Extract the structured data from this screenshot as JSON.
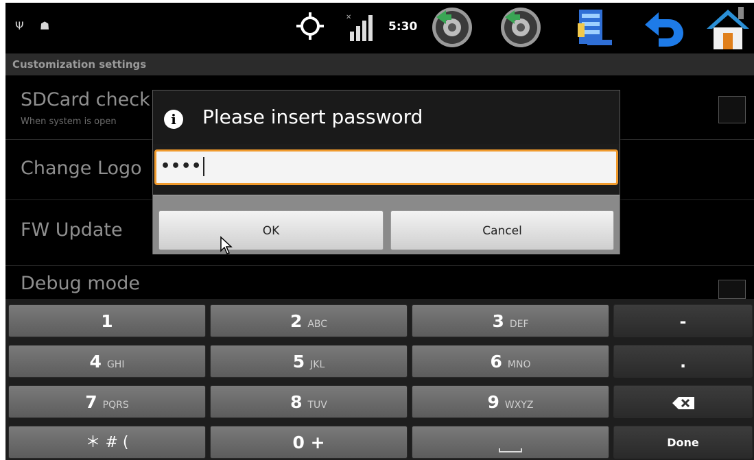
{
  "status_bar": {
    "usb_glyph": "Ψ",
    "android_glyph": "☗",
    "signal_x": "✕",
    "time": "5:30"
  },
  "settings": {
    "header": "Customization settings",
    "items": [
      {
        "title": "SDCard check",
        "subtitle": "When system is open"
      },
      {
        "title": "Change Logo",
        "subtitle": ""
      },
      {
        "title": "FW Update",
        "subtitle": ""
      },
      {
        "title": "Debug mode",
        "subtitle": ""
      }
    ]
  },
  "dialog": {
    "info_glyph": "i",
    "title": "Please insert password",
    "password_value": "••••",
    "ok_label": "OK",
    "cancel_label": "Cancel"
  },
  "keypad": {
    "keys": [
      {
        "num": "1",
        "letters": ""
      },
      {
        "num": "2",
        "letters": "ABC"
      },
      {
        "num": "3",
        "letters": "DEF"
      },
      {
        "num": "-",
        "letters": ""
      },
      {
        "num": "4",
        "letters": "GHI"
      },
      {
        "num": "5",
        "letters": "JKL"
      },
      {
        "num": "6",
        "letters": "MNO"
      },
      {
        "num": ".",
        "letters": ""
      },
      {
        "num": "7",
        "letters": "PQRS"
      },
      {
        "num": "8",
        "letters": "TUV"
      },
      {
        "num": "9",
        "letters": "WXYZ"
      },
      {
        "num": "",
        "letters": ""
      },
      {
        "num": "＊ # (",
        "letters": ""
      },
      {
        "num": "0 +",
        "letters": ""
      },
      {
        "num": "",
        "letters": ""
      },
      {
        "num": "Done",
        "letters": ""
      }
    ]
  },
  "colors": {
    "accent_orange": "#f09a2c",
    "background": "#000000",
    "dialog_buttonbar": "#8a8a8a"
  },
  "icons": [
    "usb-icon",
    "android-debug-icon",
    "gps-crosshair-icon",
    "signal-icon",
    "speaker-icon",
    "speaker-icon",
    "bookmark-icon",
    "back-arrow-icon",
    "home-icon",
    "info-icon",
    "backspace-icon"
  ]
}
